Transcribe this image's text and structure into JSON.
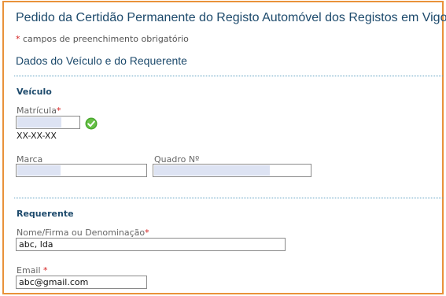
{
  "form": {
    "title": "Pedido da Certidão Permanente do Registo Automóvel dos Registos em Vigor",
    "required_marker": "*",
    "required_note": "campos de preenchimento obrigatório",
    "section_title": "Dados do Veículo e do Requerente"
  },
  "vehicle": {
    "heading": "Veículo",
    "plate_label": "Matrícula",
    "plate_format_hint": "XX-XX-XX",
    "plate_status_icon": "valid-check-icon",
    "brand_label": "Marca",
    "frame_label": "Quadro Nº"
  },
  "requester": {
    "heading": "Requerente",
    "name_label": "Nome/Firma ou Denominação",
    "name_value": "abc, lda",
    "email_label": "Email",
    "email_value": "abc@gmail.com"
  },
  "colors": {
    "frame_border": "#e9923a",
    "heading": "#1d4a6c",
    "required": "#d42020",
    "divider": "#5d9fc1",
    "valid": "#4aa82e"
  }
}
